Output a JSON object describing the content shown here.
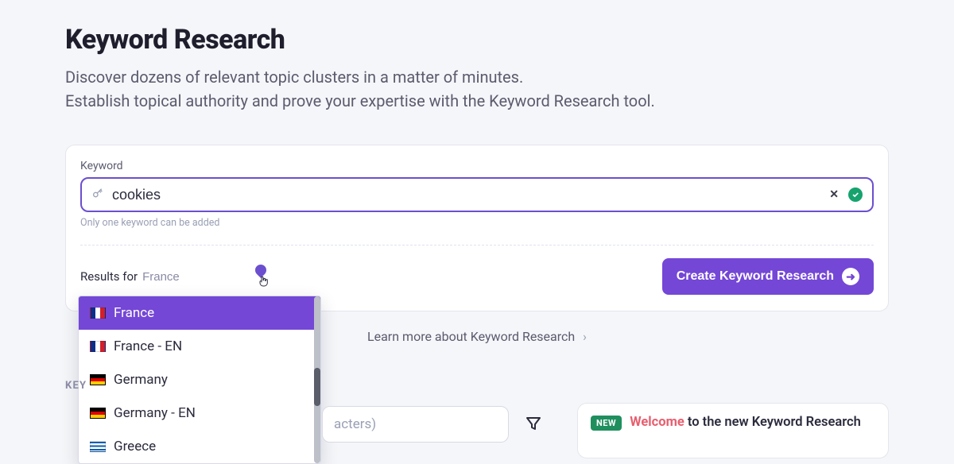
{
  "header": {
    "title": "Keyword Research",
    "subtitle_line1": "Discover dozens of relevant topic clusters in a matter of minutes.",
    "subtitle_line2": "Establish topical authority and prove your expertise with the Keyword Research tool."
  },
  "keyword_card": {
    "label": "Keyword",
    "value": "cookies",
    "placeholder": "",
    "hint": "Only one keyword can be added",
    "results_for_label": "Results for",
    "country_input_value": "France",
    "create_button": "Create Keyword Research"
  },
  "country_dropdown": {
    "options": [
      {
        "label": "France",
        "flag": "fr",
        "selected": true
      },
      {
        "label": "France - EN",
        "flag": "fr",
        "selected": false
      },
      {
        "label": "Germany",
        "flag": "de",
        "selected": false
      },
      {
        "label": "Germany - EN",
        "flag": "de",
        "selected": false
      },
      {
        "label": "Greece",
        "flag": "gr",
        "selected": false
      }
    ]
  },
  "learn_more": {
    "text": "Learn more about Keyword Research"
  },
  "section_label": "KEY",
  "peek_search": {
    "placeholder_fragment": "acters)"
  },
  "welcome_card": {
    "badge": "NEW",
    "accent_word": "Welcome",
    "rest": " to the new Keyword Research"
  }
}
